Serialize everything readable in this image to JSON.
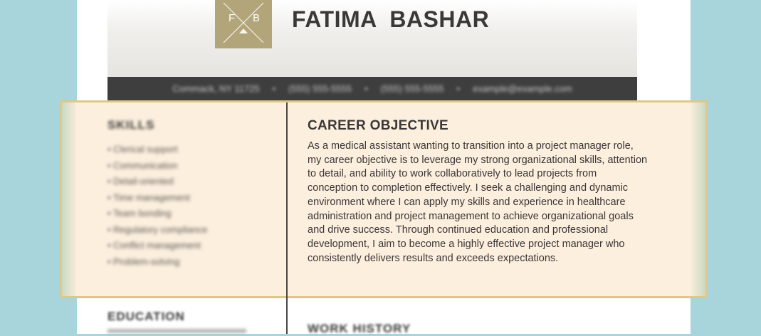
{
  "header": {
    "monogram": {
      "letter_left": "F",
      "letter_right": "B"
    },
    "name": "FATIMA  BASHAR"
  },
  "contact": {
    "location": "Commack, NY 11725",
    "phone_1": "(555) 555-5555",
    "phone_2": "(555) 555-5555",
    "email": "example@example.com"
  },
  "skills": {
    "title": "SKILLS",
    "items": [
      "• Clerical support",
      "• Communication",
      "• Detail-oriented",
      "• Time management",
      "• Team bonding",
      "• Regulatory compliance",
      "• Conflict management",
      "• Problem-solving"
    ]
  },
  "objective": {
    "title": "CAREER OBJECTIVE",
    "text": "As a medical assistant wanting to transition into a project manager role, my career objective is to leverage my strong organizational skills, attention to detail, and ability to work collaboratively to lead projects from conception to completion effectively. I seek a challenging and dynamic environment where I can apply my skills and experience in healthcare administration and project management to achieve organizational goals and drive success. Through continued education and professional development, I aim to become a highly effective project manager who consistently delivers results and exceeds expectations."
  },
  "education": {
    "title": "EDUCATION"
  },
  "work_history": {
    "title": "WORK HISTORY"
  },
  "colors": {
    "background": "#a8d4dc",
    "monogram": "#b3a57a",
    "contact_bar": "#3f3e3f",
    "highlight_fill": "#fcefde",
    "highlight_border": "#dcc98a",
    "heading": "#3a3838"
  }
}
